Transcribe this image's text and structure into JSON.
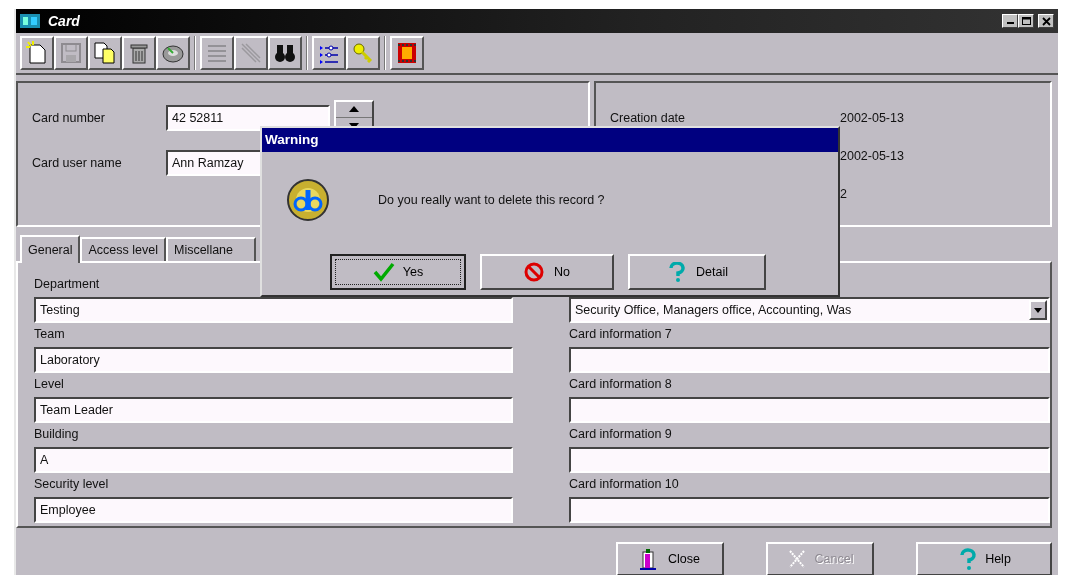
{
  "window": {
    "title": "Card"
  },
  "toolbar": [
    [
      {
        "disabled": false
      },
      {
        "disabled": true
      },
      {
        "disabled": false
      },
      {
        "disabled": false
      },
      {
        "disabled": false
      }
    ],
    [
      {
        "disabled": true
      },
      {
        "disabled": true
      },
      {
        "disabled": false
      }
    ],
    [
      {
        "disabled": false
      },
      {
        "disabled": false
      }
    ],
    [
      {
        "disabled": false
      }
    ]
  ],
  "card_number": {
    "label": "Card number",
    "value": "42 52811"
  },
  "card_user_name": {
    "label": "Card user name",
    "value": "Ann Ramzay"
  },
  "info": [
    {
      "label": "Creation date",
      "value": "2002-05-13"
    },
    {
      "value": "2002-05-13"
    },
    {
      "value": "2"
    }
  ],
  "tabs": [
    {
      "label": "General",
      "selected": true
    },
    {
      "label": "Access level",
      "selected": false
    },
    {
      "label": "Miscellane",
      "selected": false
    }
  ],
  "left_fields": [
    {
      "label": "Department",
      "value": "Testing"
    },
    {
      "label": "Team",
      "value": "Laboratory"
    },
    {
      "label": "Level",
      "value": "Team Leader"
    },
    {
      "label": "Building",
      "value": "A"
    },
    {
      "label": "Security level",
      "value": "Employee"
    }
  ],
  "right_fields": [
    {
      "kind": "combo",
      "value": "Security  Office, Managers office, Accounting, Was"
    },
    {
      "kind": "text",
      "label": "Card information 7"
    },
    {
      "kind": "text",
      "label": "Card information 8"
    },
    {
      "kind": "text",
      "label": "Card information 9"
    },
    {
      "kind": "text",
      "label": "Card information 10"
    }
  ],
  "buttons": [
    {
      "kind": "close",
      "label": "Close",
      "disabled": false
    },
    {
      "kind": "cancel",
      "label": "Cancel",
      "disabled": true
    },
    {
      "kind": "help",
      "label": "Help",
      "disabled": false
    }
  ],
  "dialog": {
    "title": "Warning",
    "message": "Do you really want to delete this record ?",
    "buttons": [
      {
        "kind": "yes",
        "label": "Yes",
        "default": true
      },
      {
        "kind": "no",
        "label": "No",
        "default": false
      },
      {
        "kind": "detail",
        "label": "Detail",
        "default": false
      }
    ]
  }
}
